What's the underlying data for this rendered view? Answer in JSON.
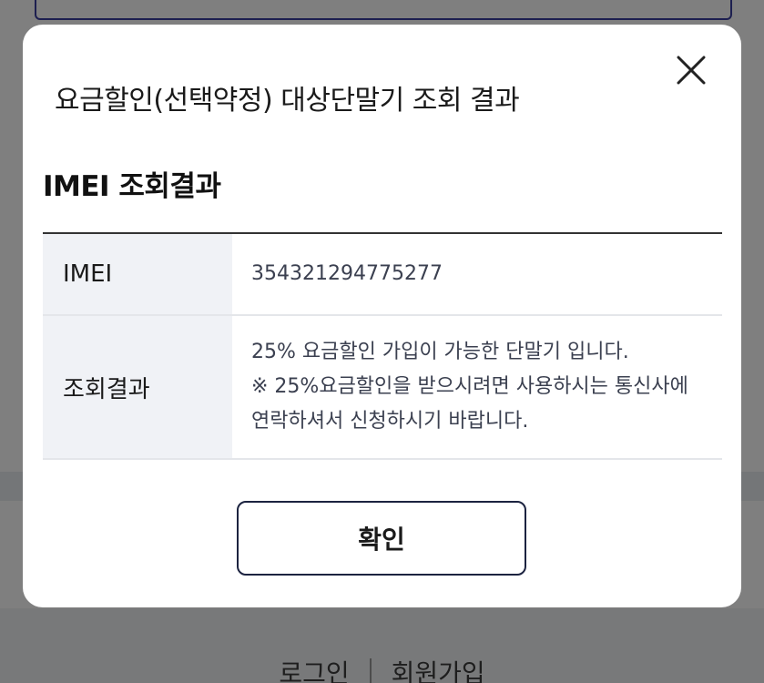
{
  "background": {
    "footer_links": [
      "로그인",
      "회원가입"
    ]
  },
  "modal": {
    "title": "요금할인(선택약정) 대상단말기 조회 결과",
    "close_icon": "close-icon",
    "section_title": "IMEI 조회결과",
    "table": {
      "imei_label": "IMEI",
      "imei_value": "354321294775277",
      "result_label": "조회결과",
      "result_lines": [
        "25% 요금할인 가입이 가능한 단말기 입니다.",
        "※ 25%요금할인을 받으시려면 사용하시는 통신사에",
        "연락하셔서 신청하시기 바랍니다."
      ]
    },
    "confirm_label": "확인"
  },
  "colors": {
    "overlay": "rgba(0,0,0,0.5)",
    "label_cell_bg": "#f0f2f6",
    "button_border": "#1c2340"
  }
}
